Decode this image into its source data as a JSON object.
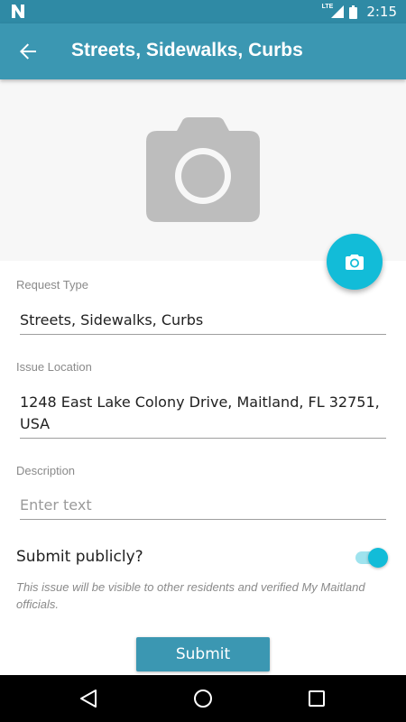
{
  "status_bar": {
    "time": "2:15",
    "network": "LTE",
    "icons": [
      "notification-n-icon",
      "signal-icon",
      "battery-icon"
    ]
  },
  "app_bar": {
    "title": "Streets, Sidewalks, Curbs",
    "back_icon": "arrow-back-icon"
  },
  "photo": {
    "placeholder_icon": "camera-icon",
    "add_photo_icon": "camera-icon"
  },
  "form": {
    "request_type": {
      "label": "Request Type",
      "value": "Streets, Sidewalks, Curbs"
    },
    "issue_location": {
      "label": "Issue Location",
      "value": "1248 East Lake Colony Drive, Maitland, FL 32751, USA"
    },
    "description": {
      "label": "Description",
      "value": "",
      "placeholder": "Enter text"
    },
    "submit_publicly": {
      "label": "Submit publicly?",
      "checked": true,
      "helper": "This issue will be visible to other residents and verified My Maitland officials."
    },
    "submit_label": "Submit"
  },
  "nav_bar": {
    "buttons": [
      "back-triangle-icon",
      "home-circle-icon",
      "recents-square-icon"
    ]
  },
  "colors": {
    "primary": "#3b97b2",
    "status_bar": "#2f8aa5",
    "accent": "#12bcd8"
  }
}
